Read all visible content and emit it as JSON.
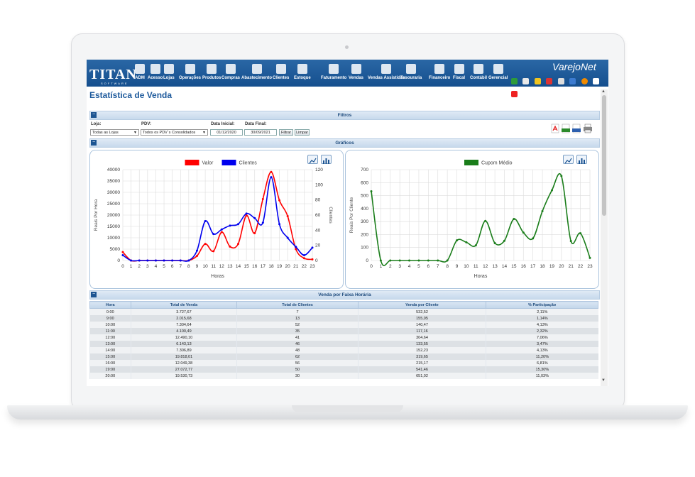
{
  "app": {
    "logo_text": "TITAN",
    "logo_sub": "SOFTWARE",
    "brand": "VarejoNet",
    "page_title": "Estatística de Venda"
  },
  "menu": [
    {
      "label": "ADM",
      "icon": "bar-chart-icon"
    },
    {
      "label": "Acesso",
      "icon": "key-icon"
    },
    {
      "label": "Lojas",
      "icon": "store-icon"
    },
    {
      "label": "Operações",
      "icon": "tools-icon"
    },
    {
      "label": "Produtos",
      "icon": "box-icon"
    },
    {
      "label": "Compras",
      "icon": "cart-icon"
    },
    {
      "label": "Abastecimento",
      "icon": "truck-icon"
    },
    {
      "label": "Clientes",
      "icon": "users-icon"
    },
    {
      "label": "Estoque",
      "icon": "package-icon"
    },
    {
      "label": "Faturamento",
      "icon": "document-icon"
    },
    {
      "label": "Vendas",
      "icon": "bag-icon"
    },
    {
      "label": "Vendas Assistidas",
      "icon": "person-icon"
    },
    {
      "label": "Tesouraria",
      "icon": "money-bag-icon"
    },
    {
      "label": "Financeiro",
      "icon": "coins-icon"
    },
    {
      "label": "Fiscal",
      "icon": "bank-icon"
    },
    {
      "label": "Contábil",
      "icon": "calculator-icon"
    },
    {
      "label": "Gerencial",
      "icon": "wrench-icon"
    }
  ],
  "filters": {
    "section_title": "Filtros",
    "loja_label": "Loja:",
    "loja_value": "Todas as Lojas",
    "pdv_label": "PDV:",
    "pdv_value": "Todos os PDV`s Consolidados",
    "data_inicial_label": "Data Inicial:",
    "data_inicial_value": "01/12/2020",
    "data_final_label": "Data Final:",
    "data_final_value": "30/09/2021",
    "filtrar_label": "Filtrar",
    "limpar_label": "Limpar"
  },
  "graficos_title": "Gráficos",
  "chart_data": [
    {
      "type": "line",
      "x": [
        0,
        1,
        2,
        3,
        4,
        5,
        6,
        7,
        8,
        9,
        10,
        11,
        12,
        13,
        14,
        15,
        16,
        17,
        18,
        19,
        20,
        21,
        22,
        23
      ],
      "series": [
        {
          "name": "Valor",
          "color": "#ff0000",
          "axis": "left",
          "values": [
            3728,
            0,
            0,
            0,
            0,
            0,
            0,
            0,
            0,
            2016,
            7305,
            4100,
            12490,
            6143,
            7307,
            19818,
            12049,
            27073,
            39000,
            26500,
            19531,
            5000,
            1000,
            500
          ]
        },
        {
          "name": "Clientes",
          "color": "#0000ee",
          "axis": "right",
          "values": [
            7,
            0,
            0,
            0,
            0,
            0,
            0,
            0,
            0,
            13,
            52,
            35,
            41,
            46,
            48,
            62,
            56,
            50,
            110,
            48,
            30,
            18,
            7,
            17
          ]
        }
      ],
      "xlabel": "Horas",
      "ylabel": "Reais Por Hora",
      "y2label": "Clientes",
      "ylim": [
        0,
        40000
      ],
      "y2lim": [
        0,
        120
      ],
      "yticks": [
        0,
        5000,
        10000,
        15000,
        20000,
        25000,
        30000,
        35000,
        40000
      ],
      "y2ticks": [
        0,
        20,
        40,
        60,
        80,
        100,
        120
      ],
      "grid": true,
      "legend": "top-center"
    },
    {
      "type": "line",
      "x": [
        0,
        1,
        2,
        3,
        4,
        5,
        6,
        7,
        8,
        9,
        10,
        11,
        12,
        13,
        14,
        15,
        16,
        17,
        18,
        19,
        20,
        21,
        22,
        23
      ],
      "series": [
        {
          "name": "Cupom Médio",
          "color": "#1a7d1a",
          "values": [
            533,
            0,
            0,
            0,
            0,
            0,
            0,
            0,
            0,
            155,
            140,
            117,
            305,
            134,
            152,
            320,
            215,
            170,
            380,
            541,
            651,
            150,
            210,
            20
          ]
        }
      ],
      "xlabel": "Horas",
      "ylabel": "Reais Por Cliente",
      "ylim": [
        0,
        700
      ],
      "yticks": [
        0,
        100,
        200,
        300,
        400,
        500,
        600,
        700
      ],
      "grid": true,
      "legend": "top-center"
    }
  ],
  "table": {
    "section_title": "Venda por Faixa Horária",
    "headers": [
      "Hora",
      "Total de Venda",
      "Total de Clientes",
      "Venda por Cliente",
      "% Participação"
    ],
    "rows": [
      [
        "0:00",
        "3.727,67",
        "7",
        "532,52",
        "2,11%"
      ],
      [
        "9:00",
        "2.015,68",
        "13",
        "155,05",
        "1,14%"
      ],
      [
        "10:00",
        "7.304,64",
        "52",
        "140,47",
        "4,13%"
      ],
      [
        "11:00",
        "4.100,49",
        "35",
        "117,16",
        "2,32%"
      ],
      [
        "12:00",
        "12.490,10",
        "41",
        "304,64",
        "7,06%"
      ],
      [
        "13:00",
        "6.143,13",
        "46",
        "133,55",
        "3,47%"
      ],
      [
        "14:00",
        "7.306,89",
        "48",
        "152,23",
        "4,13%"
      ],
      [
        "15:00",
        "19.818,01",
        "62",
        "319,65",
        "11,20%"
      ],
      [
        "16:00",
        "12.049,38",
        "56",
        "215,17",
        "6,81%"
      ],
      [
        "19:00",
        "27.072,77",
        "50",
        "541,46",
        "15,30%"
      ],
      [
        "20:00",
        "19.530,73",
        "30",
        "651,02",
        "11,03%"
      ]
    ]
  }
}
